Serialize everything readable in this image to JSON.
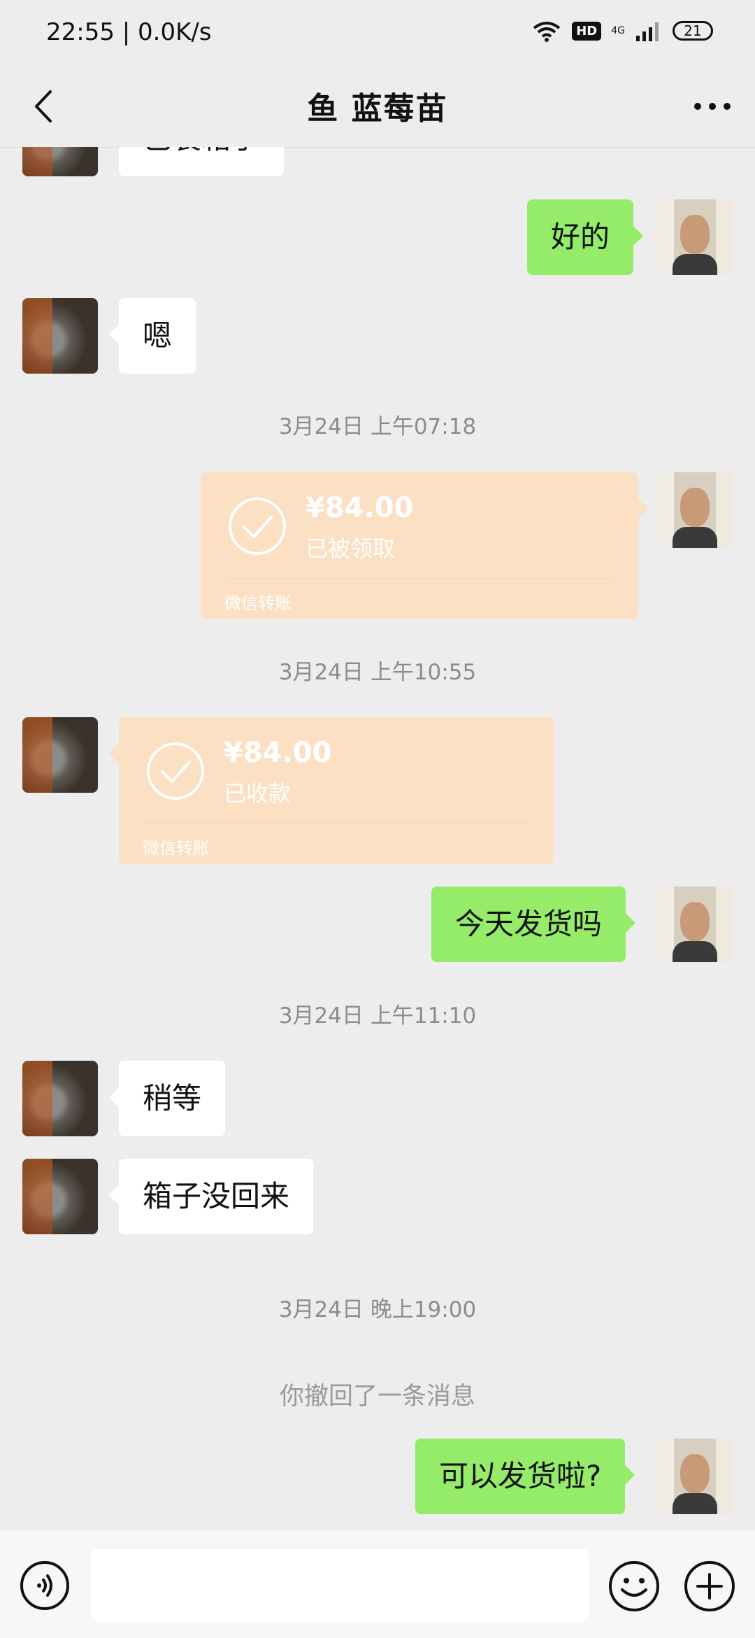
{
  "status_bar": {
    "time": "22:55 | 0.0K/s",
    "hd": "HD",
    "network": "4G",
    "battery": "21"
  },
  "header": {
    "title": "鱼 蓝莓苗",
    "back_icon": "chevron-left-icon",
    "more_icon": "more-dots-icon"
  },
  "messages": {
    "partial_top": "已装箱了",
    "m1": "好的",
    "m2": "嗯",
    "ts1": "3月24日 上午07:18",
    "transfer1": {
      "amount": "¥84.00",
      "status": "已被领取",
      "source": "微信转账"
    },
    "ts2": "3月24日 上午10:55",
    "transfer2": {
      "amount": "¥84.00",
      "status": "已收款",
      "source": "微信转账"
    },
    "m3": "今天发货吗",
    "ts3": "3月24日 上午11:10",
    "m4": "稍等",
    "m5": "箱子没回来",
    "ts4": "3月24日 晚上19:00",
    "recall": "你撤回了一条消息",
    "m6": "可以发货啦?"
  },
  "bottom_bar": {
    "input_value": "",
    "icons": [
      "voice-icon",
      "emoji-icon",
      "plus-icon"
    ]
  },
  "colors": {
    "background": "#ededed",
    "sent_bubble": "#95ec69",
    "received_bubble": "#ffffff",
    "transfer_card": "#fbe0c3"
  }
}
